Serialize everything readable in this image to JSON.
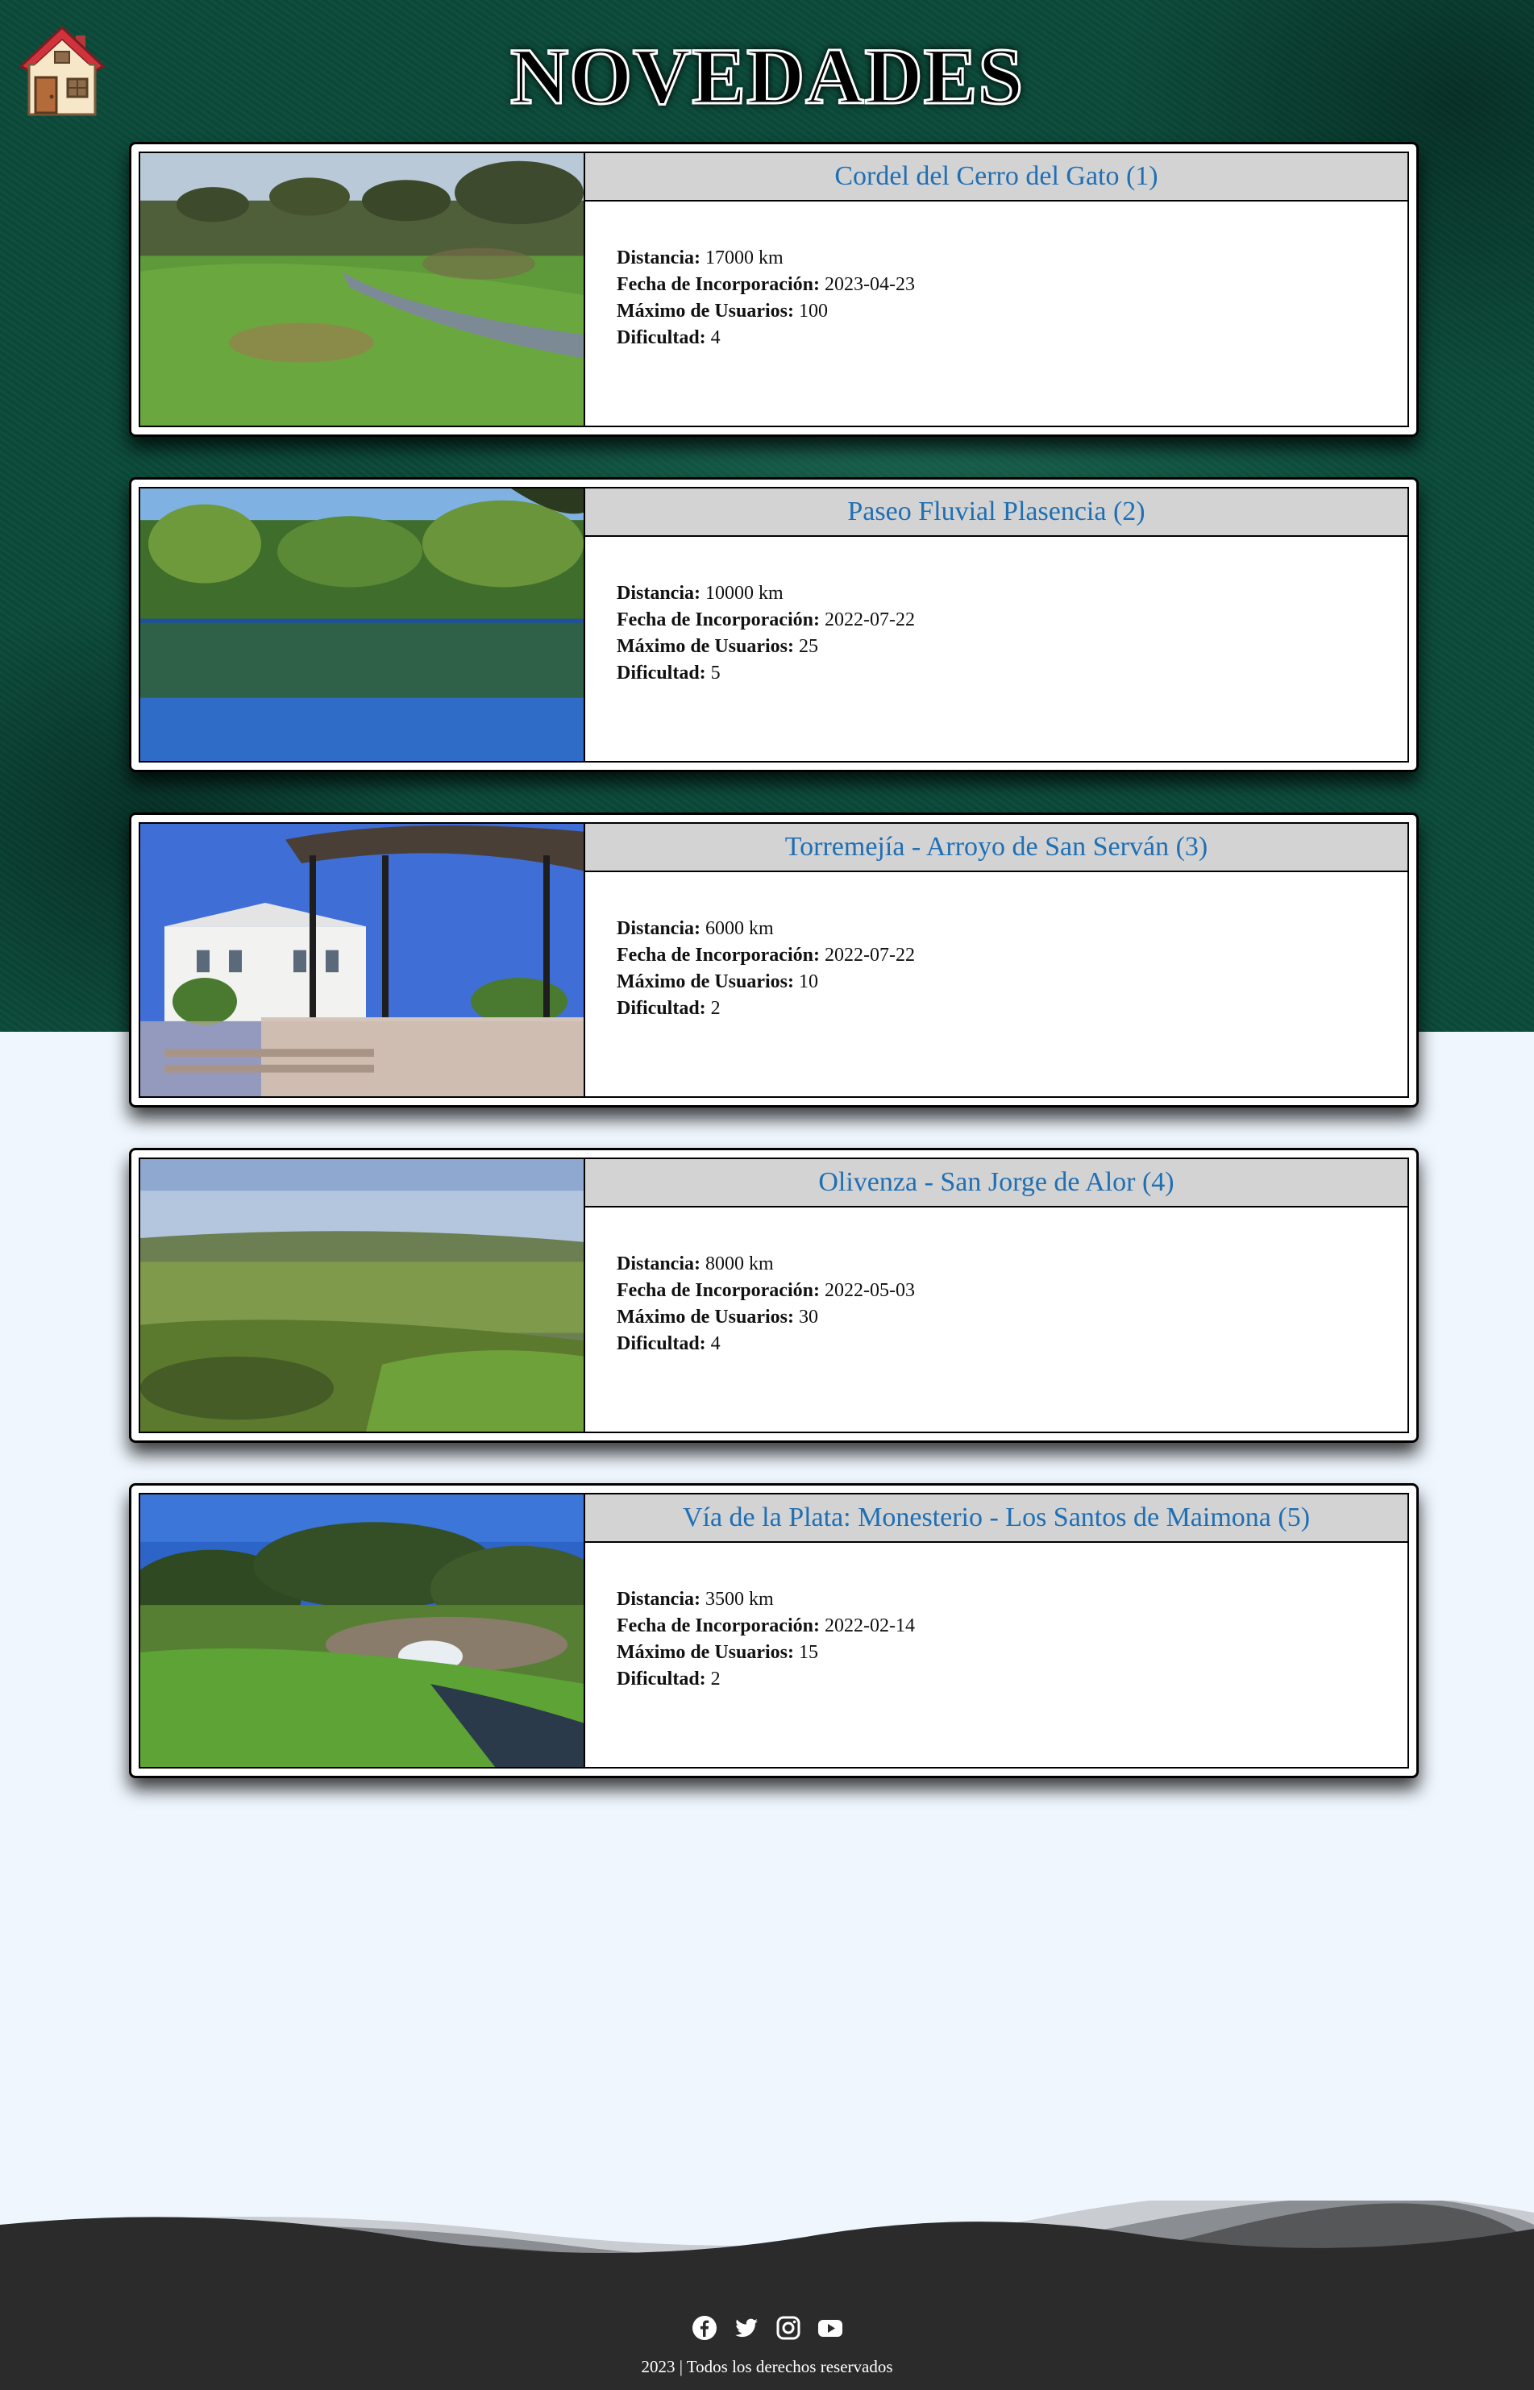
{
  "header": {
    "title": "NOVEDADES",
    "home_icon": "house-icon"
  },
  "routes": [
    {
      "title": "Cordel del Cerro del Gato (1)",
      "photo": "meadow-oak-stream",
      "distance_label": "Distancia:",
      "distance": "17000 km",
      "date_label": "Fecha de Incorporación:",
      "date": "2023-04-23",
      "users_label": "Máximo de Usuarios:",
      "users": "100",
      "difficulty_label": "Dificultad:",
      "difficulty": "4"
    },
    {
      "title": "Paseo Fluvial Plasencia (2)",
      "photo": "river-reflection",
      "distance_label": "Distancia:",
      "distance": "10000 km",
      "date_label": "Fecha de Incorporación:",
      "date": "2022-07-22",
      "users_label": "Máximo de Usuarios:",
      "users": "25",
      "difficulty_label": "Dificultad:",
      "difficulty": "5"
    },
    {
      "title": "Torremejía - Arroyo de San Serván (3)",
      "photo": "town-bandstand",
      "distance_label": "Distancia:",
      "distance": "6000 km",
      "date_label": "Fecha de Incorporación:",
      "date": "2022-07-22",
      "users_label": "Máximo de Usuarios:",
      "users": "10",
      "difficulty_label": "Dificultad:",
      "difficulty": "2"
    },
    {
      "title": "Olivenza - San Jorge de Alor (4)",
      "photo": "green-valley",
      "distance_label": "Distancia:",
      "distance": "8000 km",
      "date_label": "Fecha de Incorporación:",
      "date": "2022-05-03",
      "users_label": "Máximo de Usuarios:",
      "users": "30",
      "difficulty_label": "Dificultad:",
      "difficulty": "4"
    },
    {
      "title": "Vía de la Plata: Monesterio - Los Santos de Maimona (5)",
      "photo": "creek-waterfall",
      "distance_label": "Distancia:",
      "distance": "3500 km",
      "date_label": "Fecha de Incorporación:",
      "date": "2022-02-14",
      "users_label": "Máximo de Usuarios:",
      "users": "15",
      "difficulty_label": "Dificultad:",
      "difficulty": "2"
    }
  ],
  "footer": {
    "social": [
      "facebook-icon",
      "twitter-icon",
      "instagram-icon",
      "youtube-icon"
    ],
    "copyright": "2023 | Todos los derechos reservados"
  },
  "colors": {
    "hero_bg": "#0b4a3a",
    "page_bg": "#eff6fd",
    "card_title_bg": "#d3d3d3",
    "card_title_text": "#1f6fb4",
    "footer_bg": "#2b2b2b"
  }
}
